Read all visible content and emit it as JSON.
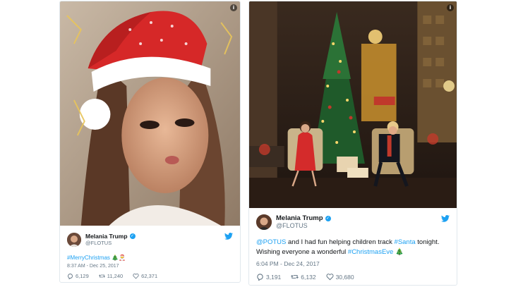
{
  "tweets": [
    {
      "author": {
        "name": "Melania Trump",
        "handle": "@FLOTUS"
      },
      "text": {
        "tag": "#MerryChristmas",
        "emoji": "🎄🎅"
      },
      "time": "8:37 AM - Dec 25, 2017",
      "stats": {
        "replies": "6,129",
        "retweets": "11,240",
        "likes": "62,371"
      }
    },
    {
      "author": {
        "name": "Melania Trump",
        "handle": "@FLOTUS"
      },
      "text": {
        "mention": "@POTUS",
        "part1": " and I had fun helping children track ",
        "tag1": "#Santa",
        "part2": " tonight. Wishing everyone a wonderful ",
        "tag2": "#ChristmasEve",
        "emoji": " 🎄"
      },
      "time": "6:04 PM - Dec 24, 2017",
      "stats": {
        "replies": "3,191",
        "retweets": "6,132",
        "likes": "30,680"
      }
    }
  ],
  "colors": {
    "link": "#1da1f2",
    "muted": "#657786",
    "border": "#e1e8ed"
  },
  "icons": [
    "info-icon",
    "twitter-bird-icon",
    "verified-badge-icon",
    "reply-icon",
    "retweet-icon",
    "like-icon"
  ]
}
